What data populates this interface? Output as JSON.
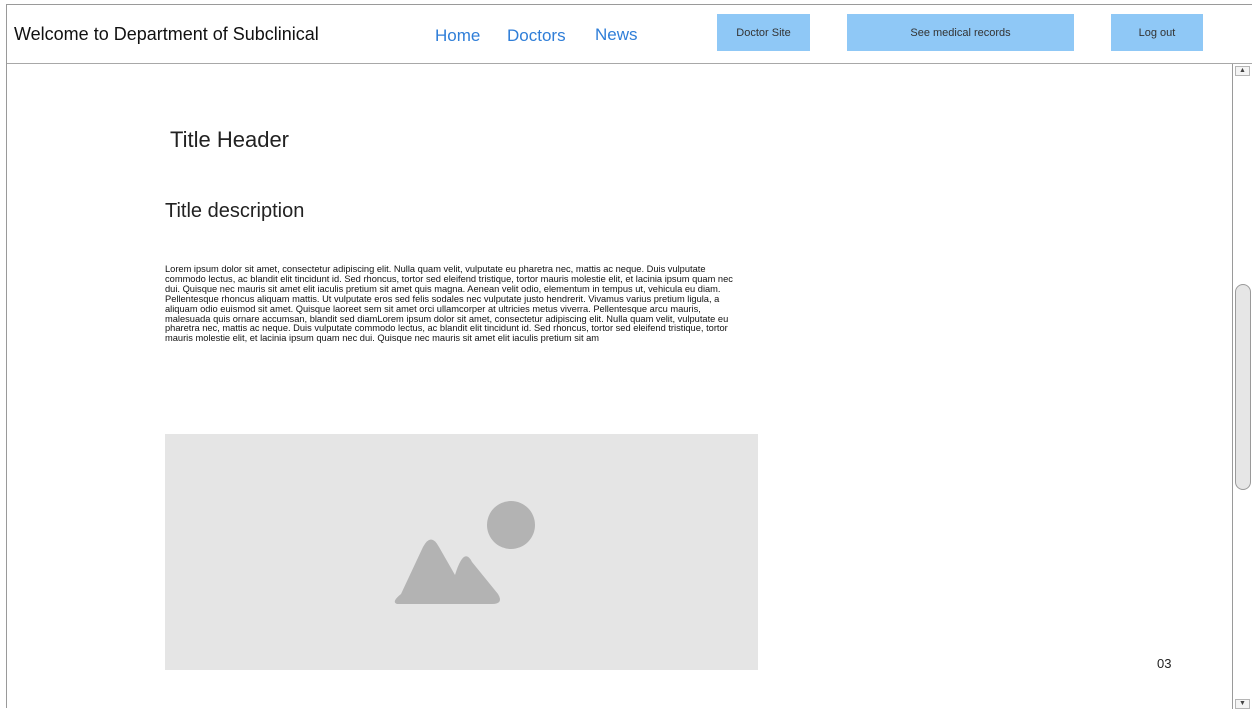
{
  "header": {
    "site_title": "Welcome to Department of Subclinical",
    "nav": {
      "home": "Home",
      "doctors": "Doctors",
      "news": "News"
    },
    "buttons": {
      "doctor_site": "Doctor Site",
      "medical_records": "See medical records",
      "log_out": "Log out"
    }
  },
  "content": {
    "title_header": "Title Header",
    "title_description": "Title description",
    "body_text": "Lorem ipsum dolor sit amet, consectetur adipiscing elit. Nulla quam velit, vulputate eu pharetra nec, mattis ac neque. Duis vulputate commodo lectus, ac blandit elit tincidunt id. Sed rhoncus, tortor sed eleifend tristique, tortor mauris molestie elit, et lacinia ipsum quam nec dui. Quisque nec mauris sit amet elit iaculis pretium sit amet quis magna. Aenean velit odio, elementum in tempus ut, vehicula eu diam. Pellentesque rhoncus aliquam mattis. Ut vulputate eros sed felis sodales nec vulputate justo hendrerit. Vivamus varius pretium ligula, a aliquam odio euismod sit amet. Quisque laoreet sem sit amet orci ullamcorper at ultricies metus viverra. Pellentesque arcu mauris, malesuada quis ornare accumsan, blandit sed diamLorem ipsum dolor sit amet, consectetur adipiscing elit. Nulla quam velit, vulputate eu pharetra nec, mattis ac neque. Duis vulputate commodo lectus, ac blandit elit tincidunt id. Sed rhoncus, tortor sed eleifend tristique, tortor mauris molestie elit, et lacinia ipsum quam nec dui. Quisque nec mauris sit amet elit iaculis pretium sit am",
    "image_icon": "image-placeholder-icon",
    "page_number": "03"
  },
  "colors": {
    "nav_link": "#2f7ed8",
    "button_bg": "#8fc8f6",
    "placeholder_bg": "#e5e5e5",
    "placeholder_icon": "#b3b3b3"
  }
}
